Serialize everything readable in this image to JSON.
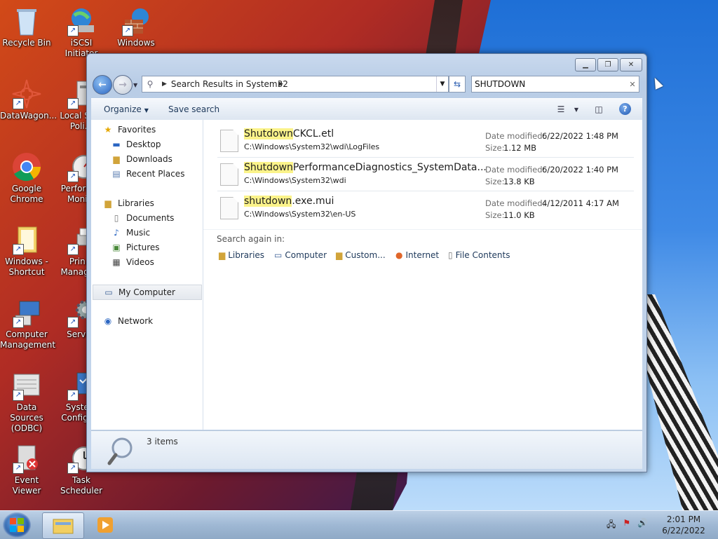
{
  "desktop": {
    "icons": [
      {
        "label": "Recycle Bin",
        "icon": "recycle-bin-icon"
      },
      {
        "label": "iSCSI Initiator",
        "icon": "iscsi-initiator-icon"
      },
      {
        "label": "Windows",
        "icon": "windows-firewall-icon"
      },
      {
        "label": "DataWagon...",
        "icon": "datawagon-icon"
      },
      {
        "label": "Local Se... Poli...",
        "icon": "local-security-policy-icon"
      },
      {
        "label": "Google Chrome",
        "icon": "chrome-icon"
      },
      {
        "label": "Perform... Moni...",
        "icon": "performance-monitor-icon"
      },
      {
        "label": "Windows - Shortcut",
        "icon": "folder-shortcut-icon"
      },
      {
        "label": "Prin... Manage...",
        "icon": "print-management-icon"
      },
      {
        "label": "Computer Management",
        "icon": "computer-management-icon"
      },
      {
        "label": "Servi...",
        "icon": "services-icon"
      },
      {
        "label": "Data Sources (ODBC)",
        "icon": "odbc-icon"
      },
      {
        "label": "Syste... Configu...",
        "icon": "system-configuration-icon"
      },
      {
        "label": "Event Viewer",
        "icon": "event-viewer-icon"
      },
      {
        "label": "Task Scheduler",
        "icon": "task-scheduler-icon"
      }
    ]
  },
  "window": {
    "address": {
      "breadcrumb": "Search Results in System32"
    },
    "search": {
      "value": "SHUTDOWN"
    },
    "toolbar": {
      "organize": "Organize",
      "save_search": "Save search"
    },
    "nav": {
      "favorites": "Favorites",
      "desktop": "Desktop",
      "downloads": "Downloads",
      "recent": "Recent Places",
      "libraries": "Libraries",
      "documents": "Documents",
      "music": "Music",
      "pictures": "Pictures",
      "videos": "Videos",
      "my_computer": "My Computer",
      "network": "Network"
    },
    "results": [
      {
        "match": "Shutdown",
        "rest": "CKCL.etl",
        "path": "C:\\Windows\\System32\\wdi\\LogFiles",
        "date_label": "Date modified:",
        "date": "6/22/2022 1:48 PM",
        "size_label": "Size:",
        "size": "1.12 MB"
      },
      {
        "match": "Shutdown",
        "rest": "PerformanceDiagnostics_SystemData...",
        "path": "C:\\Windows\\System32\\wdi",
        "date_label": "Date modified:",
        "date": "6/20/2022 1:40 PM",
        "size_label": "Size:",
        "size": "13.8 KB"
      },
      {
        "match": "shutdown",
        "rest": ".exe.mui",
        "path": "C:\\Windows\\System32\\en-US",
        "date_label": "Date modified:",
        "date": "4/12/2011 4:17 AM",
        "size_label": "Size:",
        "size": "11.0 KB"
      }
    ],
    "search_again": {
      "heading": "Search again in:",
      "items": [
        "Libraries",
        "Computer",
        "Custom...",
        "Internet",
        "File Contents"
      ]
    },
    "details": {
      "count": "3 items"
    }
  },
  "taskbar": {
    "clock_time": "2:01 PM",
    "clock_date": "6/22/2022"
  },
  "colors": {
    "highlight": "#fbf38a",
    "link": "#1e395b"
  }
}
